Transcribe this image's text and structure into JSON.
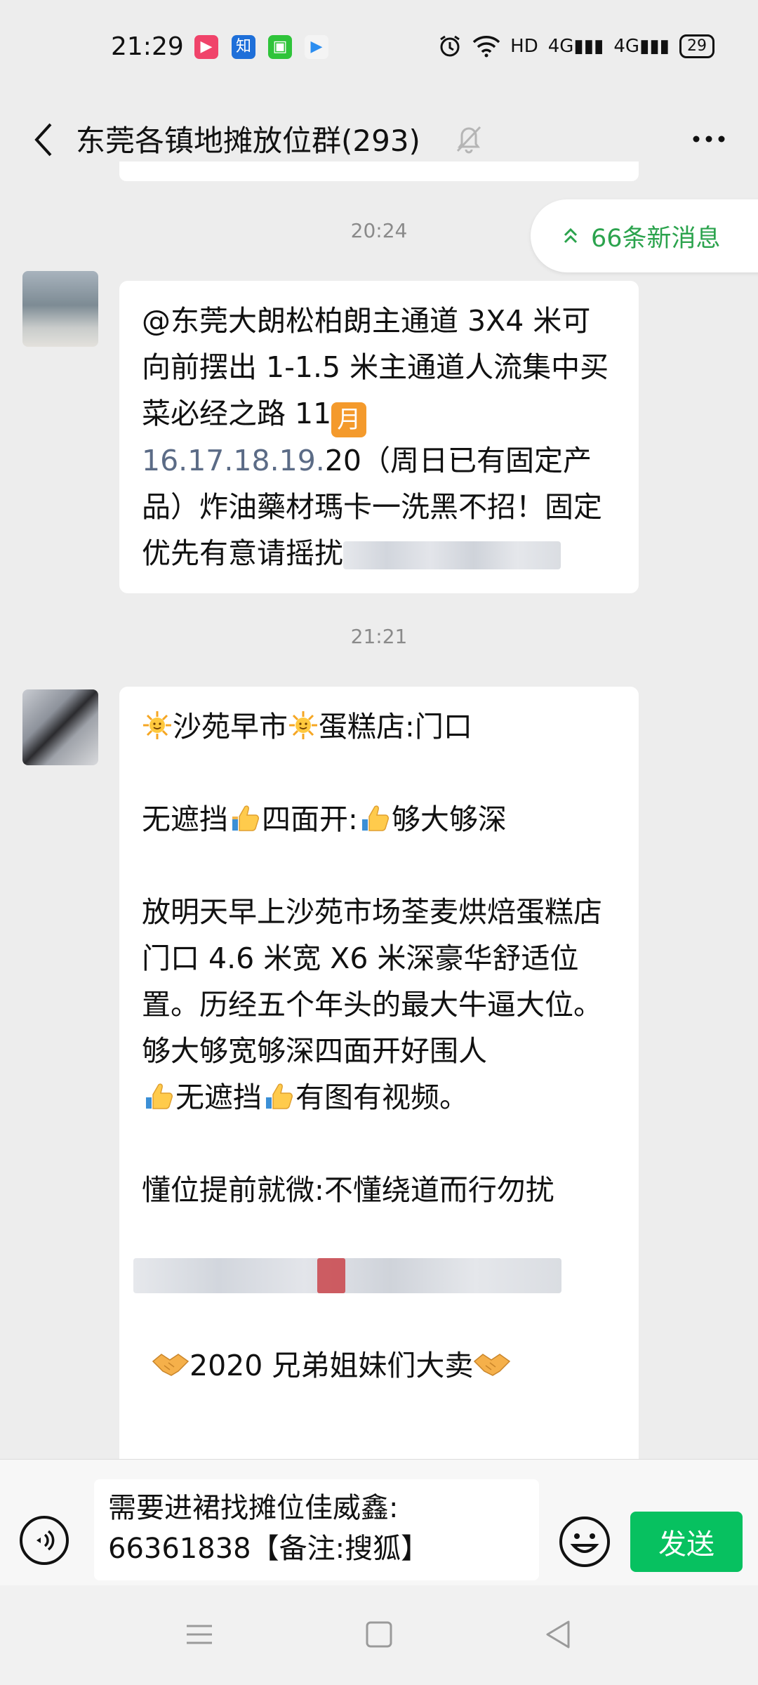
{
  "status_bar": {
    "time": "21:29",
    "net1": "HD",
    "net2": "4G",
    "net3": "4G",
    "battery": "29"
  },
  "header": {
    "title": "东莞各镇地摊放位群(293)"
  },
  "chat": {
    "new_messages": "66条新消息",
    "messages": [
      {
        "timestamp": "20:24",
        "text": {
          "line1": "@东莞大朗松柏朗主通道 3X4 米可向前摆出 1-1.5 米主通道人流集中买菜必经之路 11",
          "moon": "月",
          "dates": "16.17.18.19.",
          "line2": "20（周日已有固定产品）炸油藥材瑪卡一洗黑不招！固定优先有意请摇扰"
        }
      },
      {
        "timestamp": "21:21",
        "p1a": "沙苑早市",
        "p1b": "蛋糕店:门口",
        "p2a": "无遮挡",
        "p2b": "四面开:",
        "p2c": "够大够深",
        "p3": "放明天早上沙苑市场荃麦烘焙蛋糕店门口 4.6 米宽 X6 米深豪华舒适位置。历经五个年头的最大牛逼大位。够大够宽够深四面开好围人",
        "p3b": "无遮挡",
        "p3c": "有图有视频。",
        "p4": "懂位提前就微:不懂绕道而行勿扰",
        "p5": "2020 兄弟姐妹们大卖"
      }
    ]
  },
  "input_bar": {
    "text": "需要进裙找摊位佳威鑫:\n66361838【备注:搜狐】",
    "send": "发送"
  },
  "colors": {
    "accent_green": "#07c160",
    "new_msg_green": "#2ba34d",
    "background": "#ededed"
  },
  "icons": [
    "back-arrow-icon",
    "mute-bell-icon",
    "more-dots-icon",
    "voice-icon",
    "emoji-face-icon",
    "sun-emoji-icon",
    "thumbs-up-emoji-icon",
    "handshake-emoji-icon",
    "menu-nav-icon",
    "home-nav-icon",
    "back-nav-icon"
  ]
}
